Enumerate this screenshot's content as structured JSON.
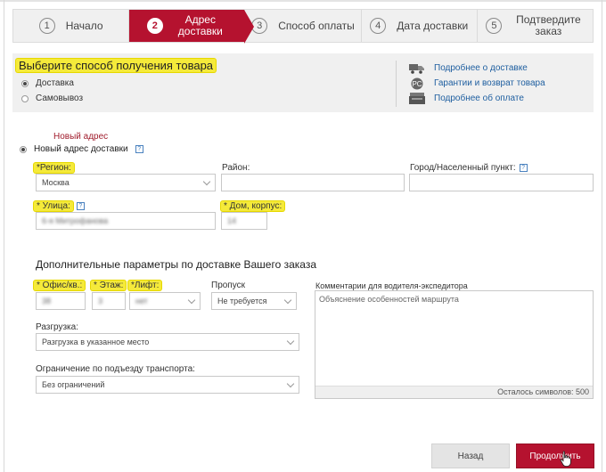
{
  "steps": [
    {
      "num": "1",
      "label": "Начало"
    },
    {
      "num": "2",
      "label": "Адрес доставки"
    },
    {
      "num": "3",
      "label": "Способ оплаты"
    },
    {
      "num": "4",
      "label": "Дата доставки"
    },
    {
      "num": "5",
      "label": "Подтвердите заказ"
    }
  ],
  "active_step": 2,
  "method": {
    "title": "Выберите способ получения товара",
    "options": [
      "Доставка",
      "Самовывоз"
    ],
    "selected": "Доставка"
  },
  "info_links": [
    {
      "icon": "truck-icon",
      "label": "Подробнее о доставке"
    },
    {
      "icon": "guarantee-icon",
      "label": "Гарантии и возврат товара"
    },
    {
      "icon": "register-icon",
      "label": "Подробнее об оплате"
    }
  ],
  "address": {
    "new_address_caption": "Новый адрес",
    "new_address_option": "Новый адрес доставки",
    "region_label": "*Регион:",
    "region_value": "Москва",
    "district_label": "Район:",
    "district_value": "",
    "city_label": "Город/Населенный пункт:",
    "city_value": "",
    "street_label": "* Улица:",
    "street_value": "6-я Митрофанова",
    "house_label": "* Дом, корпус:",
    "house_value": "14"
  },
  "extra": {
    "title": "Дополнительные параметры по доставке Вашего заказа",
    "office_label": "* Офис/кв.:",
    "office_value": "38",
    "floor_label": "* Этаж:",
    "floor_value": "3",
    "lift_label": "*Лифт:",
    "lift_value": "нет",
    "pass_label": "Пропуск",
    "pass_value": "Не требуется",
    "unload_label": "Разгрузка:",
    "unload_value": "Разгрузка в указанное место",
    "restriction_label": "Ограничение по подъезду транспорта:",
    "restriction_value": "Без ограничений",
    "comment_label": "Комментарии для водителя-экспедитора",
    "comment_placeholder": "Объяснение особенностей маршрута",
    "chars_left": "Осталось символов: 500"
  },
  "buttons": {
    "back": "Назад",
    "next": "Продолжить"
  },
  "colors": {
    "accent": "#b5122f",
    "highlight": "#f5ea3a",
    "link": "#1f5fa0"
  }
}
